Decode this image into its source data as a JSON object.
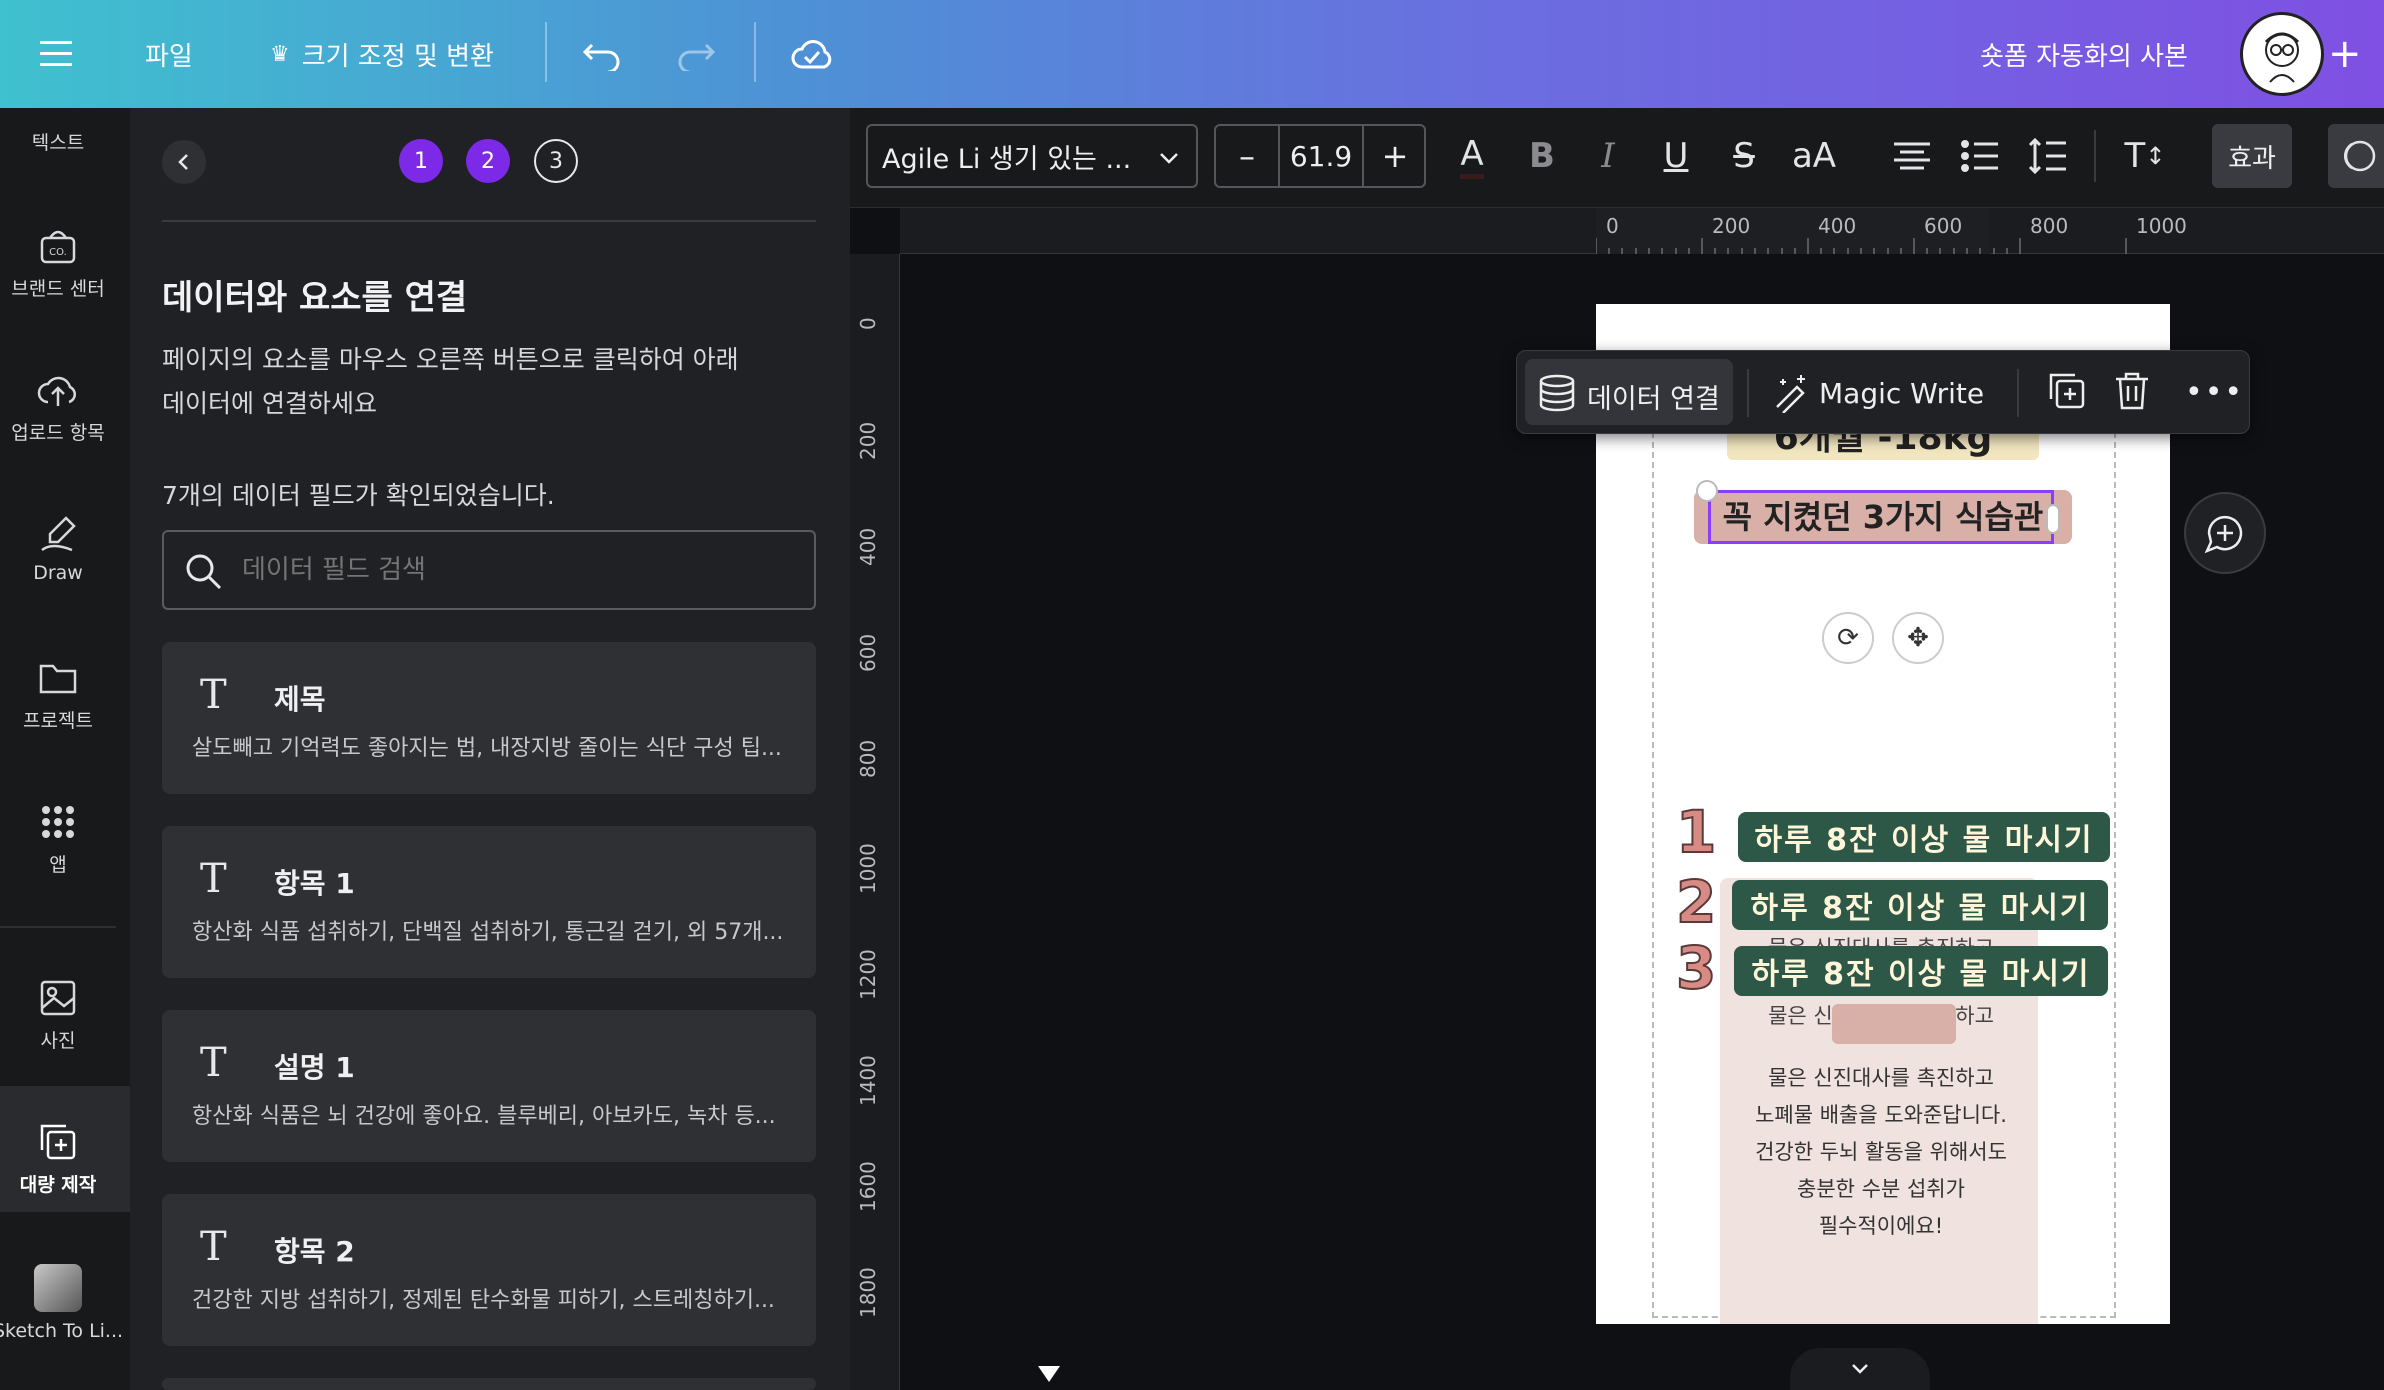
{
  "topbar": {
    "file_label": "파일",
    "resize_label": "크기 조정 및 변환",
    "doc_title": "숏폼 자동화의 사본",
    "crown_icon": "crown-icon",
    "colors": {
      "start": "#3fc1cf",
      "end": "#7f50e3"
    }
  },
  "rail": {
    "items": [
      {
        "label": "텍스트",
        "icon": "text-icon"
      },
      {
        "label": "브랜드 센터",
        "icon": "brand-icon"
      },
      {
        "label": "업로드 항목",
        "icon": "upload-icon"
      },
      {
        "label": "Draw",
        "icon": "draw-icon"
      },
      {
        "label": "프로젝트",
        "icon": "folder-icon"
      },
      {
        "label": "앱",
        "icon": "apps-icon"
      },
      {
        "label": "사진",
        "icon": "photo-icon"
      },
      {
        "label": "대량 제작",
        "icon": "bulk-create-icon"
      },
      {
        "label": "Sketch To Li...",
        "icon": "sketch-app-icon"
      }
    ]
  },
  "panel": {
    "steps": [
      "1",
      "2",
      "3"
    ],
    "heading": "데이터와 요소를 연결",
    "description_line1": "페이지의 요소를 마우스 오른쪽 버튼으로 클릭하여 아래",
    "description_line2": "데이터에 연결하세요",
    "count_text": "7개의 데이터 필드가 확인되었습니다.",
    "search_placeholder": "데이터 필드 검색",
    "fields": [
      {
        "name": "제목",
        "value": "살도빼고 기억력도 좋아지는 법, 내장지방 줄이는 식단 구성 팁..."
      },
      {
        "name": "항목 1",
        "value": "항산화 식품 섭취하기, 단백질 섭취하기, 통근길 걷기, 외 57개..."
      },
      {
        "name": "설명 1",
        "value": "항산화 식품은 뇌 건강에 좋아요. 블루베리, 아보카도, 녹차 등..."
      },
      {
        "name": "항목 2",
        "value": "건강한 지방 섭취하기, 정제된 탄수화물 피하기, 스트레칭하기..."
      }
    ]
  },
  "textbar": {
    "font_name": "Agile Li 생기 있는 ...",
    "font_size": "61.9",
    "minus": "–",
    "plus": "+",
    "effects_label": "효과"
  },
  "ruler": {
    "h": [
      "0",
      "200",
      "400",
      "600",
      "800",
      "1000"
    ],
    "v": [
      "0",
      "200",
      "400",
      "600",
      "800",
      "1000",
      "1200",
      "1400",
      "1600",
      "1800"
    ]
  },
  "floatbar": {
    "connect_label": "데이터 연결",
    "magic_label": "Magic Write"
  },
  "design": {
    "top_banner": "6개월 -18kg",
    "subtitle": "꼭 지켰던 3가지 식습관",
    "items": [
      {
        "num": "1",
        "text": "하루 8잔 이상 물 마시기"
      },
      {
        "num": "2",
        "text": "하루 8잔 이상 물 마시기"
      },
      {
        "num": "3",
        "text": "하루 8잔 이상 물 마시기"
      }
    ],
    "overlap_1": "물은 신진대사를 촉진하고",
    "overlap_2": "물은 신진대사를 촉진하고",
    "body": [
      "물은 신진대사를 촉진하고",
      "노폐물 배출을 도와준답니다.",
      "건강한 두뇌 활동을 위해서도",
      "충분한 수분 섭취가",
      "필수적이에요!"
    ],
    "colors": {
      "pill": "#2d5747",
      "num": "#d88a84",
      "subtitle_bg": "#d8b0a7",
      "banner_bg": "#f2e6c0",
      "card_bg": "#f0e2de"
    }
  }
}
